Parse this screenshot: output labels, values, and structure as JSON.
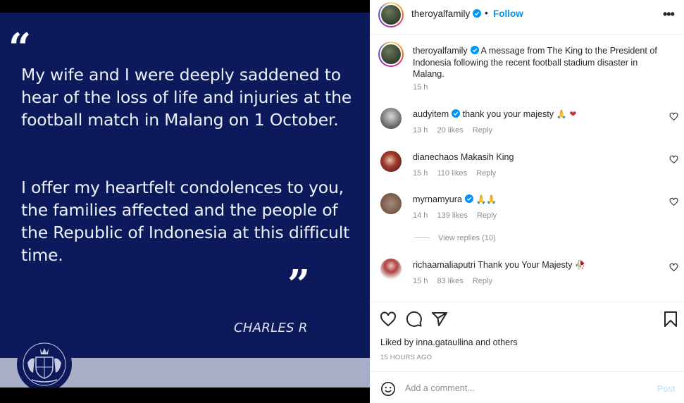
{
  "post": {
    "quote_open": "“",
    "quote_close": "”",
    "paragraph1": "My wife and I were deeply saddened to hear of the loss of life and injuries at the football match in Malang on 1 October.",
    "paragraph2": "I offer my heartfelt condolences to you, the families affected and the people of the Republic of Indonesia at this difficult time.",
    "signature": "CHARLES R",
    "colors": {
      "background": "#0c1a5c",
      "band": "#a9aec7"
    }
  },
  "header": {
    "username": "theroyalfamily",
    "separator": "•",
    "follow_label": "Follow",
    "more_icon": "more-horizontal-icon",
    "more_glyph": "•••"
  },
  "caption": {
    "username": "theroyalfamily",
    "text": "A message from The King to the President of Indonesia following the recent football stadium disaster in Malang.",
    "time": "15 h"
  },
  "comments": [
    {
      "username": "audyitem",
      "verified": true,
      "text": "thank you your majesty",
      "emoji": "🙏 ❤",
      "time": "13 h",
      "likes": "20 likes",
      "reply": "Reply"
    },
    {
      "username": "dianechaos",
      "verified": false,
      "text": "Makasih King",
      "emoji": "",
      "time": "15 h",
      "likes": "110 likes",
      "reply": "Reply"
    },
    {
      "username": "myrnamyura",
      "verified": true,
      "text": "",
      "emoji": "🙏🙏",
      "time": "14 h",
      "likes": "139 likes",
      "reply": "Reply"
    },
    {
      "username": "richaamaliaputri",
      "verified": false,
      "text": "Thank you Your Majesty",
      "emoji": "🥀",
      "time": "15 h",
      "likes": "83 likes",
      "reply": "Reply"
    }
  ],
  "view_replies": "View replies (10)",
  "actions": {
    "icons": [
      "heart-icon",
      "comment-icon",
      "share-icon",
      "bookmark-icon"
    ],
    "liked_by_prefix": "Liked by",
    "liked_by_user": "inna.gataullina",
    "liked_by_and": "and",
    "liked_by_others": "others",
    "post_time": "15 HOURS AGO"
  },
  "comment_box": {
    "placeholder": "Add a comment...",
    "post_label": "Post",
    "emoji_icon": "smiley-icon"
  },
  "colors": {
    "link": "#0095f6",
    "muted": "#8e8e8e",
    "text": "#262626"
  }
}
